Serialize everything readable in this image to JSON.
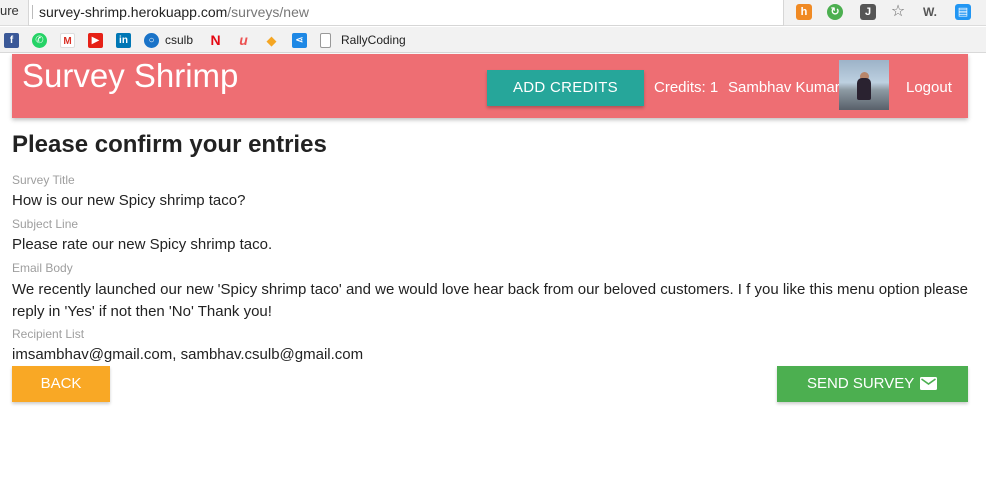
{
  "browser": {
    "left_cut_text": "ure",
    "url_host": "survey-shrimp.herokuapp.com",
    "url_path": "/surveys/new",
    "bookmarks": [
      {
        "icon": "facebook-icon",
        "label": ""
      },
      {
        "icon": "whatsapp-icon",
        "label": ""
      },
      {
        "icon": "gmail-icon",
        "label": ""
      },
      {
        "icon": "youtube-icon",
        "label": ""
      },
      {
        "icon": "linkedin-icon",
        "label": ""
      },
      {
        "icon": "csulb-icon",
        "label": "csulb"
      },
      {
        "icon": "netflix-icon",
        "label": ""
      },
      {
        "icon": "udemy-icon",
        "label": ""
      },
      {
        "icon": "hackerrank-icon",
        "label": ""
      },
      {
        "icon": "share-icon",
        "label": ""
      },
      {
        "icon": "page-icon",
        "label": "RallyCoding"
      }
    ]
  },
  "nav": {
    "brand": "Survey Shrimp",
    "add_credits": "ADD CREDITS",
    "credits": "Credits: 1",
    "username": "Sambhav Kumar",
    "logout": "Logout"
  },
  "review": {
    "heading": "Please confirm your entries",
    "fields": [
      {
        "label": "Survey Title",
        "value": "How is our new Spicy shrimp taco?"
      },
      {
        "label": "Subject Line",
        "value": "Please rate our new Spicy shrimp taco."
      },
      {
        "label": "Email Body",
        "value": "We recently launched our new 'Spicy shrimp taco' and we would love hear back from our beloved customers. I f you like this menu option please reply in 'Yes' if not then 'No' Thank you!"
      },
      {
        "label": "Recipient List",
        "value": "imsambhav@gmail.com, sambhav.csulb@gmail.com"
      }
    ],
    "back_label": "BACK",
    "send_label": "SEND SURVEY"
  },
  "colors": {
    "nav": "#ee6e73",
    "add_credits": "#26a69a",
    "back": "#f9a825",
    "send": "#4caf50"
  }
}
